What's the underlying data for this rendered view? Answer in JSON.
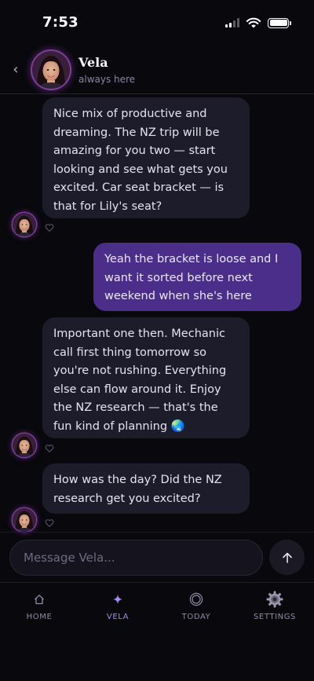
{
  "status_bar": {
    "time": "7:53"
  },
  "header": {
    "back_icon": "chevron-left-icon",
    "name": "Vela",
    "status": "always here"
  },
  "messages": [
    {
      "sender": "vela",
      "text": "Nice mix of productive and dreaming. The NZ trip will be amazing for you two — start looking and see what gets you excited. Car seat bracket — is that for Lily's seat?"
    },
    {
      "sender": "user",
      "text": "Yeah the bracket is loose and I want it sorted before next weekend when she's here"
    },
    {
      "sender": "vela",
      "text": "Important one then. Mechanic call first thing tomorrow so you're not rushing. Everything else can flow around it. Enjoy the NZ research — that's the fun kind of planning 🌏"
    },
    {
      "sender": "vela",
      "text": "How was the day? Did the NZ research get you excited?"
    }
  ],
  "composer": {
    "placeholder": "Message Vela...",
    "send_icon": "arrow-up-icon"
  },
  "tabs": [
    {
      "label": "HOME",
      "icon": "home-icon",
      "active": false
    },
    {
      "label": "VELA",
      "icon": "sparkle-icon",
      "active": true
    },
    {
      "label": "TODAY",
      "icon": "target-icon",
      "active": false
    },
    {
      "label": "SETTINGS",
      "icon": "gear-icon",
      "active": false
    }
  ],
  "colors": {
    "background": "#08080d",
    "incoming_bubble": "#1d1c2b",
    "outgoing_bubble": "#4a2e8a",
    "accent": "#a78bf0"
  }
}
